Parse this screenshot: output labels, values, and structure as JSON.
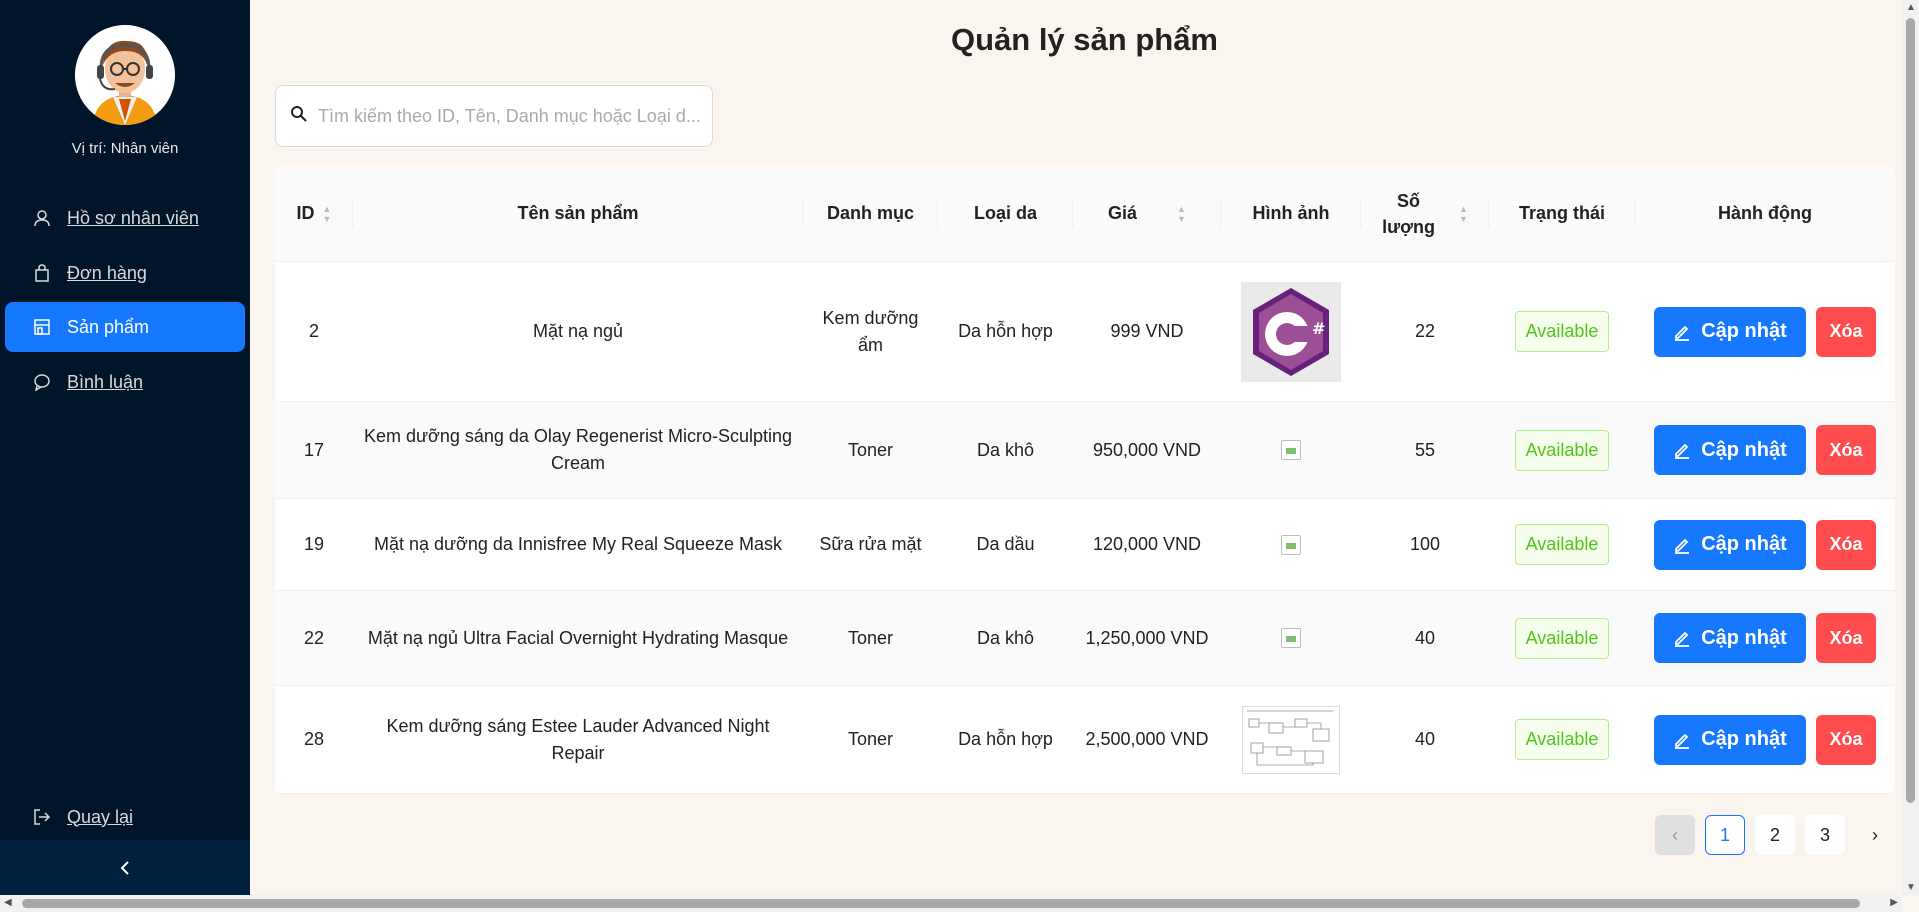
{
  "sidebar": {
    "role": "Vị trí: Nhân viên",
    "items": [
      {
        "label": "Hồ sơ nhân viên",
        "icon": "user-icon"
      },
      {
        "label": "Đơn hàng",
        "icon": "shopping-bag-icon"
      },
      {
        "label": "Sản phẩm",
        "icon": "shop-icon"
      },
      {
        "label": "Bình luận",
        "icon": "comment-icon"
      }
    ],
    "back": {
      "label": "Quay lại",
      "icon": "logout-icon"
    },
    "collapse": "<"
  },
  "page": {
    "title": "Quản lý sản phẩm"
  },
  "search": {
    "placeholder": "Tìm kiếm theo ID, Tên, Danh mục hoặc Loại d..."
  },
  "table": {
    "headers": {
      "id": "ID",
      "name": "Tên sản phẩm",
      "category": "Danh mục",
      "skin": "Loại da",
      "price": "Giá",
      "image": "Hình ảnh",
      "qty_1": "Số",
      "qty_2": "lượng",
      "status": "Trạng thái",
      "action": "Hành động"
    },
    "rows": [
      {
        "id": "2",
        "name": "Mặt nạ ngủ",
        "category": "Kem dưỡng ẩm",
        "skin": "Da hỗn hợp",
        "price": "999 VND",
        "image": "csharp-logo",
        "qty": "22",
        "status": "Available",
        "update": "Cập nhật",
        "delete": "Xóa"
      },
      {
        "id": "17",
        "name": "Kem dưỡng sáng da Olay Regenerist Micro-Sculpting Cream",
        "category": "Toner",
        "skin": "Da khô",
        "price": "950,000 VND",
        "image": "broken",
        "qty": "55",
        "status": "Available",
        "update": "Cập nhật",
        "delete": "Xóa"
      },
      {
        "id": "19",
        "name": "Mặt nạ dưỡng da Innisfree My Real Squeeze Mask",
        "category": "Sữa rửa mặt",
        "skin": "Da dầu",
        "price": "120,000 VND",
        "image": "broken",
        "qty": "100",
        "status": "Available",
        "update": "Cập nhật",
        "delete": "Xóa"
      },
      {
        "id": "22",
        "name": "Mặt nạ ngủ Ultra Facial Overnight Hydrating Masque",
        "category": "Toner",
        "skin": "Da khô",
        "price": "1,250,000 VND",
        "image": "broken",
        "qty": "40",
        "status": "Available",
        "update": "Cập nhật",
        "delete": "Xóa"
      },
      {
        "id": "28",
        "name": "Kem dưỡng sáng Estee Lauder Advanced Night Repair",
        "category": "Toner",
        "skin": "Da hỗn hợp",
        "price": "2,500,000 VND",
        "image": "diagram",
        "qty": "40",
        "status": "Available",
        "update": "Cập nhật",
        "delete": "Xóa"
      }
    ]
  },
  "pagination": {
    "prev": "‹",
    "pages": [
      "1",
      "2",
      "3"
    ],
    "current": "1",
    "next": "›"
  },
  "colors": {
    "primary": "#1677ff",
    "danger": "#ff4d4f",
    "sidebar": "#001529",
    "success": "#52c41a",
    "background": "#faf6ef"
  }
}
